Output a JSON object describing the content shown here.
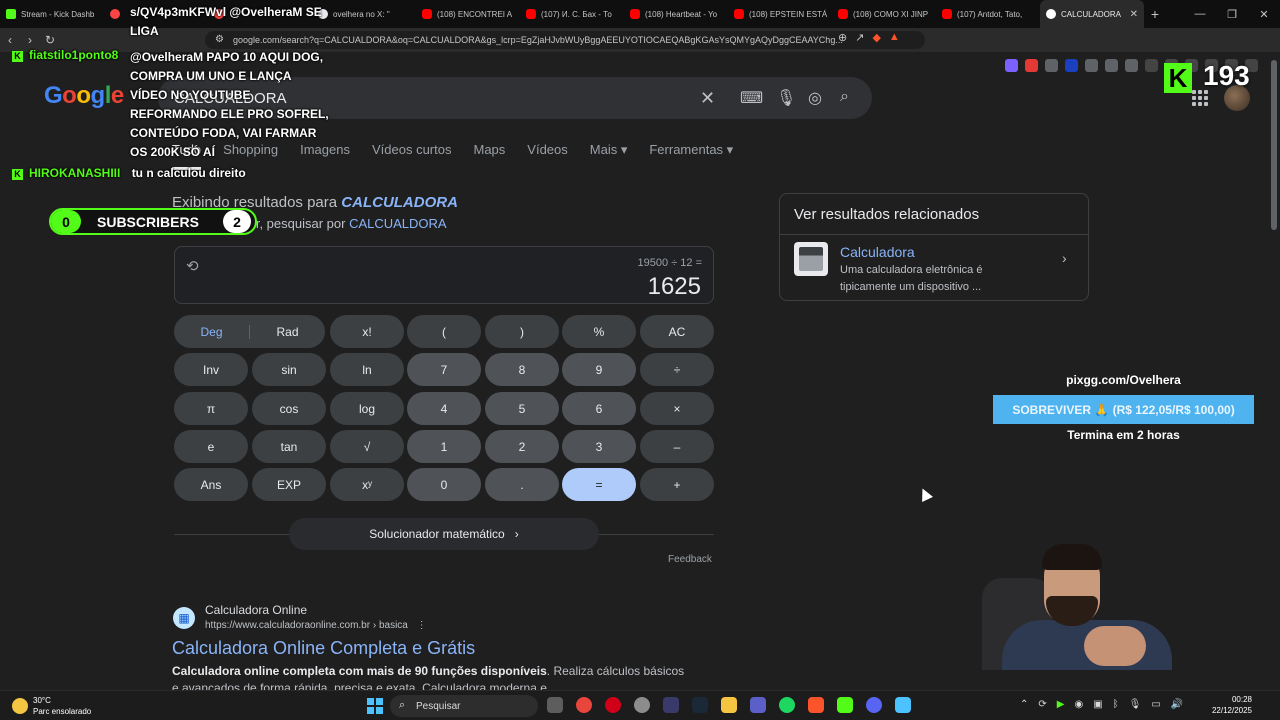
{
  "browser": {
    "tabs": [
      {
        "label": "Stream - Kick Dashb",
        "color": "#53fc18"
      },
      {
        "label": "",
        "color": "#ff4444"
      },
      {
        "label": "",
        "color": "#ff4444"
      },
      {
        "label": "ovelhera no X: \"",
        "color": "#e8eaed"
      },
      {
        "label": "(108) ENCONTREI A",
        "color": "#ff0000"
      },
      {
        "label": "(107) И. С. Бах - То",
        "color": "#ff0000"
      },
      {
        "label": "(108) Heartbeat - Yo",
        "color": "#ff0000"
      },
      {
        "label": "(108) EPSTEIN ESTÁ",
        "color": "#ff0000"
      },
      {
        "label": "(108) COMO XI JINP",
        "color": "#ff0000"
      },
      {
        "label": "(107) Antdot, Tato, ",
        "color": "#ff0000"
      },
      {
        "label": "CALCULADORA",
        "color": "#ffffff"
      }
    ],
    "url": "google.com/search?q=CALCUALDORA&oq=CALCUALDORA&gs_lcrp=EgZjaHJvbWUyBggAEEUYOTIOCAEQABgKGAsYsQMYgAQyDggCEAAYChg..."
  },
  "google": {
    "query": "CALCUALDORA",
    "tabs": [
      "Tudo",
      "Shopping",
      "Imagens",
      "Vídeos curtos",
      "Maps",
      "Vídeos",
      "Mais",
      "Ferramentas"
    ],
    "showing_prefix": "Exibindo resultados para",
    "showing_term": "CALCULADORA",
    "instead_prefix": "Você quis dizer, pesquisar por",
    "instead_term": "CALCUALDORA"
  },
  "calculator": {
    "expression": "19500 ÷ 12 =",
    "result": "1625",
    "deg": "Deg",
    "rad": "Rad",
    "buttons": [
      "x!",
      "(",
      ")",
      "%",
      "AC",
      "Inv",
      "sin",
      "ln",
      "7",
      "8",
      "9",
      "÷",
      "π",
      "cos",
      "log",
      "4",
      "5",
      "6",
      "×",
      "e",
      "tan",
      "√",
      "1",
      "2",
      "3",
      "–",
      "Ans",
      "EXP",
      "xʸ",
      "0",
      ".",
      "=",
      "+"
    ],
    "solver": "Solucionador matemático",
    "feedback": "Feedback"
  },
  "result": {
    "site": "Calculadora Online",
    "url": "https://www.calculadoraonline.com.br › basica",
    "title": "Calculadora Online Completa e Grátis",
    "snippet_bold": "Calculadora online completa com mais de 90 funções disponíveis",
    "snippet_rest": ". Realiza cálculos básicos e avançados de forma rápida, precisa e exata. Calculadora moderna e..."
  },
  "related": {
    "header": "Ver resultados relacionados",
    "name": "Calculadora",
    "description": "Uma calculadora eletrônica é tipicamente um dispositivo ..."
  },
  "overlay": {
    "chat": [
      {
        "user": "fiatstilo1ponto8",
        "message": "@OvelheraM PAPO 10 AQUI DOG, COMPRA UM UNO E LANÇA VÍDEO NO YOUTUBE REFORMANDO ELE PRO SOFREL, CONTEÚDO FODA, VAI FARMAR OS 200K SÓ AÍ"
      },
      {
        "user": "HIROKANASHIII",
        "message": "tu n calculou direito"
      }
    ],
    "chat_top": "s/QV4p3mKFWvl @OvelheraM SE LIGA",
    "subs_left": "0",
    "subs_label": "SUBSCRIBERS",
    "subs_right": "2",
    "viewers": "193",
    "pix_url": "pixgg.com/Ovelhera",
    "pix_goal": "SOBREVIVER 🙏 (R$ 122,05/R$ 100,00)",
    "pix_end": "Termina em 2 horas"
  },
  "taskbar": {
    "temp": "30°C",
    "weather": "Parc ensolarado",
    "search": "Pesquisar",
    "time": "00:28",
    "date": "22/12/2025"
  }
}
